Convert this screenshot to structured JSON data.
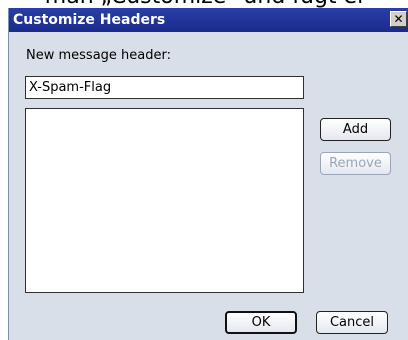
{
  "caption_fragment": "man „Customize\" und fügt ei",
  "dialog": {
    "title": "Customize Headers",
    "close_glyph": "✕",
    "header_label": "New message header:",
    "header_value": "X-Spam-Flag",
    "headers_list": [],
    "buttons": {
      "add": "Add",
      "remove": "Remove",
      "ok": "OK",
      "cancel": "Cancel"
    },
    "remove_enabled": false
  },
  "colors": {
    "titlebar": "#1a2a8c",
    "dialog_background": "#d8dfe9",
    "disabled_text": "#9aa6b8"
  }
}
